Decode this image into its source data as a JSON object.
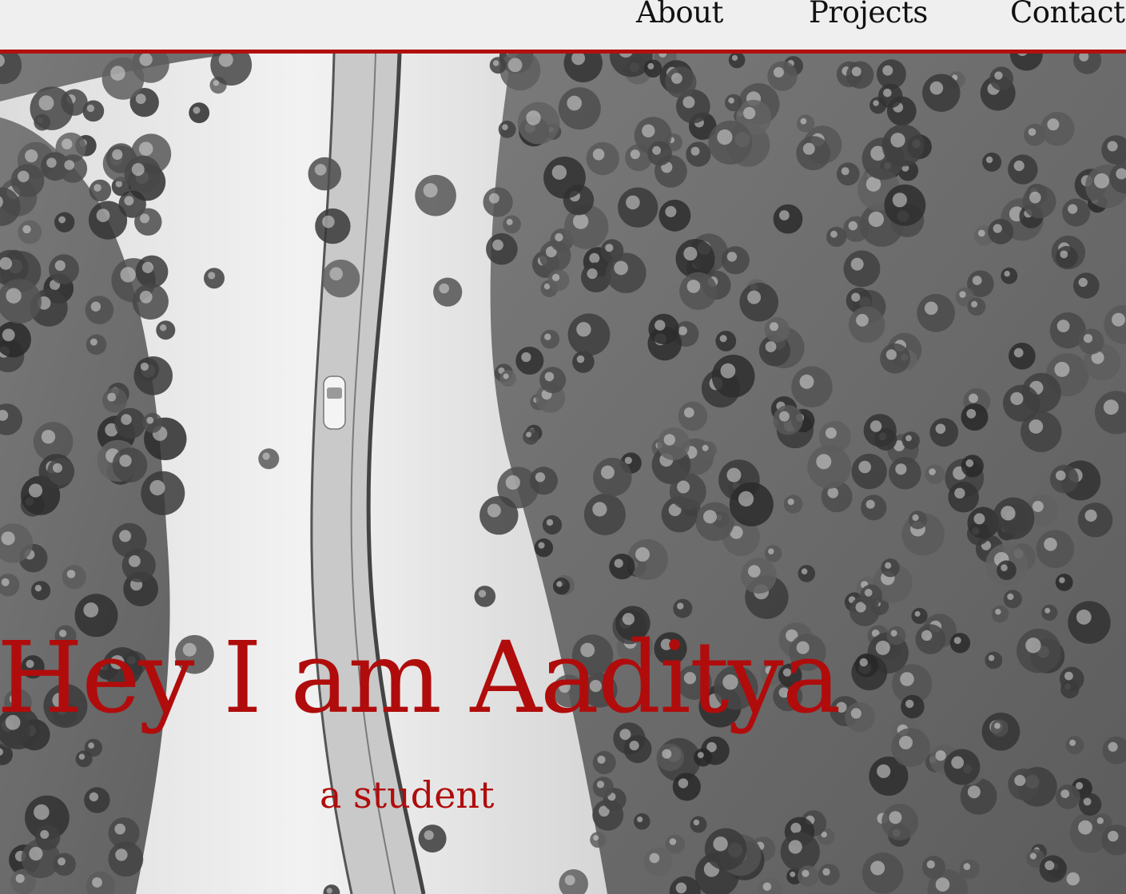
{
  "nav": {
    "items": [
      {
        "label": "About"
      },
      {
        "label": "Projects"
      },
      {
        "label": "Contact"
      }
    ]
  },
  "hero": {
    "title": "Hey I am Aaditya",
    "subtitle": "a student",
    "image": "aerial photo of a snowy road through a pine forest with a single car"
  },
  "colors": {
    "accent": "#b00c0c",
    "nav_background": "#efefef",
    "nav_text": "#111111"
  }
}
